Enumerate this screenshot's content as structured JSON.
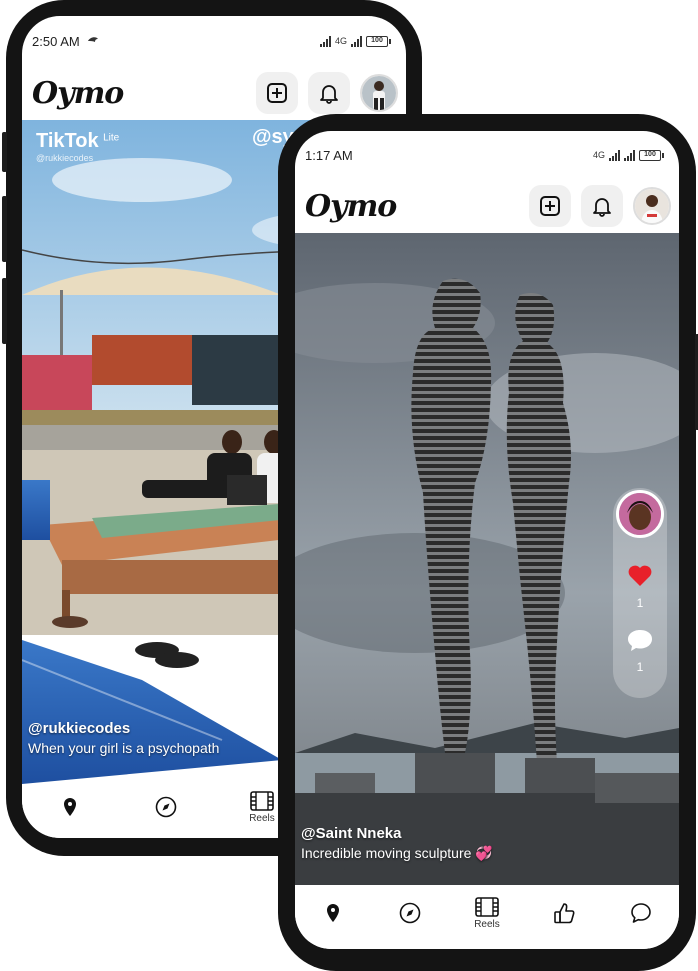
{
  "back_phone": {
    "status": {
      "time": "2:50 AM",
      "network": "4G",
      "battery": "100"
    },
    "header": {
      "logo": "Oymo"
    },
    "overlay": {
      "tiktok_brand": "TikTok",
      "tiktok_sub": "Lite",
      "tiktok_handle": "@rukkiecodes",
      "top_handle_partial": "@sy"
    },
    "caption": {
      "user": "@rukkiecodes",
      "text": "When your girl is a psychopath"
    },
    "nav": {
      "reels_label": "Reels"
    }
  },
  "front_phone": {
    "status": {
      "time": "1:17 AM",
      "network": "4G",
      "battery": "100"
    },
    "header": {
      "logo": "Oymo"
    },
    "rail": {
      "like_count": "1",
      "comment_count": "1"
    },
    "caption": {
      "user": "@Saint Nneka",
      "text": "Incredible moving sculpture 💞"
    },
    "nav": {
      "reels_label": "Reels"
    }
  },
  "colors": {
    "like": "#e8202a",
    "dark": "#141414"
  },
  "icons": [
    "plus-square-icon",
    "bell-icon",
    "location-pin-icon",
    "compass-icon",
    "film-icon",
    "thumbs-up-icon",
    "chat-bubble-icon",
    "heart-icon"
  ]
}
